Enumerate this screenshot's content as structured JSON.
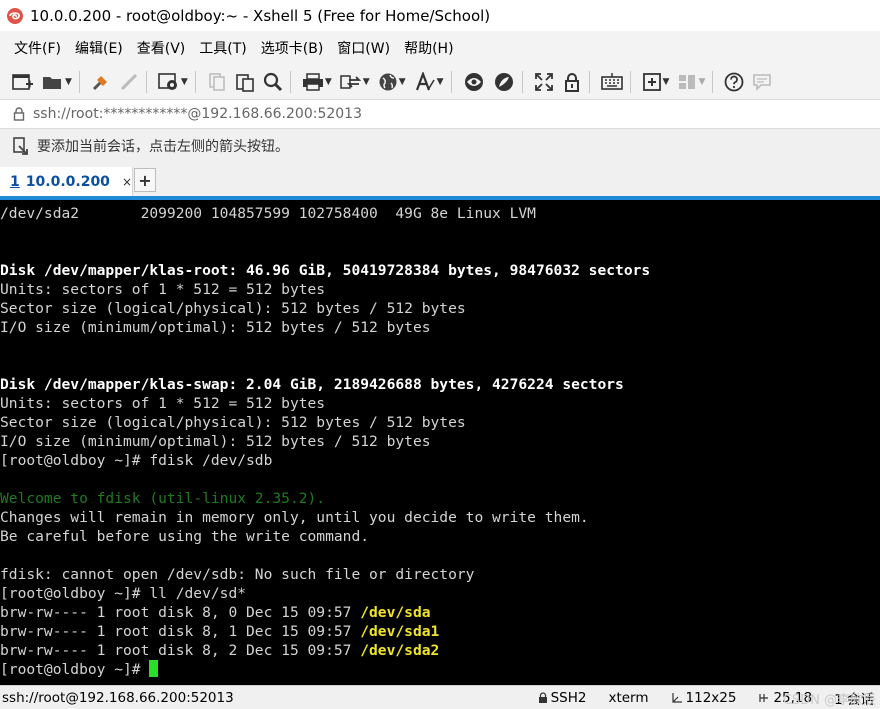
{
  "window": {
    "title": "10.0.0.200 - root@oldboy:~ - Xshell 5 (Free for Home/School)"
  },
  "menu": [
    {
      "label": "文件(F)"
    },
    {
      "label": "编辑(E)"
    },
    {
      "label": "查看(V)"
    },
    {
      "label": "工具(T)"
    },
    {
      "label": "选项卡(B)"
    },
    {
      "label": "窗口(W)"
    },
    {
      "label": "帮助(H)"
    }
  ],
  "toolbar_icons": [
    "new-session-icon",
    "open-folder-icon",
    "connect-icon",
    "disconnect-icon",
    "properties-icon",
    "copy-icon",
    "paste-icon",
    "find-icon",
    "print-icon",
    "transfer-icon",
    "globe-icon",
    "font-icon",
    "xftp-icon",
    "xmanager-icon",
    "fullscreen-icon",
    "lock-icon",
    "keyboard-icon",
    "compose-icon",
    "layout-icon",
    "help-icon",
    "chat-icon"
  ],
  "address": {
    "value": "ssh://root:************@192.168.66.200:52013"
  },
  "hint": {
    "text": "要添加当前会话，点击左侧的箭头按钮。"
  },
  "tabs": [
    {
      "number": "1",
      "label": "10.0.0.200",
      "close": "×",
      "status_color": "#21b24b"
    }
  ],
  "new_tab_label": "+",
  "terminal": {
    "lines": [
      {
        "segments": [
          {
            "text": "/dev/sda2       2099200 104857599 102758400  49G 8e Linux LVM",
            "style": "normal"
          }
        ]
      },
      {
        "segments": [
          {
            "text": "",
            "style": "normal"
          }
        ]
      },
      {
        "segments": [
          {
            "text": "",
            "style": "normal"
          }
        ]
      },
      {
        "segments": [
          {
            "text": "Disk /dev/mapper/klas-root: 46.96 GiB, 50419728384 bytes, 98476032 sectors",
            "style": "bold"
          }
        ]
      },
      {
        "segments": [
          {
            "text": "Units: sectors of 1 * 512 = 512 bytes",
            "style": "normal"
          }
        ]
      },
      {
        "segments": [
          {
            "text": "Sector size (logical/physical): 512 bytes / 512 bytes",
            "style": "normal"
          }
        ]
      },
      {
        "segments": [
          {
            "text": "I/O size (minimum/optimal): 512 bytes / 512 bytes",
            "style": "normal"
          }
        ]
      },
      {
        "segments": [
          {
            "text": "",
            "style": "normal"
          }
        ]
      },
      {
        "segments": [
          {
            "text": "",
            "style": "normal"
          }
        ]
      },
      {
        "segments": [
          {
            "text": "Disk /dev/mapper/klas-swap: 2.04 GiB, 2189426688 bytes, 4276224 sectors",
            "style": "bold"
          }
        ]
      },
      {
        "segments": [
          {
            "text": "Units: sectors of 1 * 512 = 512 bytes",
            "style": "normal"
          }
        ]
      },
      {
        "segments": [
          {
            "text": "Sector size (logical/physical): 512 bytes / 512 bytes",
            "style": "normal"
          }
        ]
      },
      {
        "segments": [
          {
            "text": "I/O size (minimum/optimal): 512 bytes / 512 bytes",
            "style": "normal"
          }
        ]
      },
      {
        "segments": [
          {
            "text": "[root@oldboy ~]# fdisk /dev/sdb",
            "style": "normal"
          }
        ]
      },
      {
        "segments": [
          {
            "text": "",
            "style": "normal"
          }
        ]
      },
      {
        "segments": [
          {
            "text": "Welcome to fdisk (util-linux 2.35.2).",
            "style": "green"
          }
        ]
      },
      {
        "segments": [
          {
            "text": "Changes will remain in memory only, until you decide to write them.",
            "style": "normal"
          }
        ]
      },
      {
        "segments": [
          {
            "text": "Be careful before using the write command.",
            "style": "normal"
          }
        ]
      },
      {
        "segments": [
          {
            "text": "",
            "style": "normal"
          }
        ]
      },
      {
        "segments": [
          {
            "text": "fdisk: cannot open /dev/sdb: No such file or directory",
            "style": "normal"
          }
        ]
      },
      {
        "segments": [
          {
            "text": "[root@oldboy ~]# ll /dev/sd*",
            "style": "normal"
          }
        ]
      },
      {
        "segments": [
          {
            "text": "brw-rw---- 1 root disk 8, 0 Dec 15 09:57 ",
            "style": "normal"
          },
          {
            "text": "/dev/sda",
            "style": "yellow"
          }
        ]
      },
      {
        "segments": [
          {
            "text": "brw-rw---- 1 root disk 8, 1 Dec 15 09:57 ",
            "style": "normal"
          },
          {
            "text": "/dev/sda1",
            "style": "yellow"
          }
        ]
      },
      {
        "segments": [
          {
            "text": "brw-rw---- 1 root disk 8, 2 Dec 15 09:57 ",
            "style": "normal"
          },
          {
            "text": "/dev/sda2",
            "style": "yellow"
          }
        ]
      },
      {
        "segments": [
          {
            "text": "[root@oldboy ~]# ",
            "style": "normal"
          }
        ],
        "cursor": true
      }
    ]
  },
  "status": {
    "connection": "ssh://root@192.168.66.200:52013",
    "protocol": "SSH2",
    "terminal_type": "xterm",
    "size": "112x25",
    "cursor_pos": "25,18",
    "sessions": "1 会话",
    "watermark": "CSDN @李欣辰"
  },
  "colors": {
    "terminal_bg": "#000000",
    "terminal_fg": "#d4d4d4",
    "green_text": "#1e7a1e",
    "yellow_text": "#f0e52a",
    "cursor": "#27e027",
    "tab_accent": "#1f8ad8"
  }
}
